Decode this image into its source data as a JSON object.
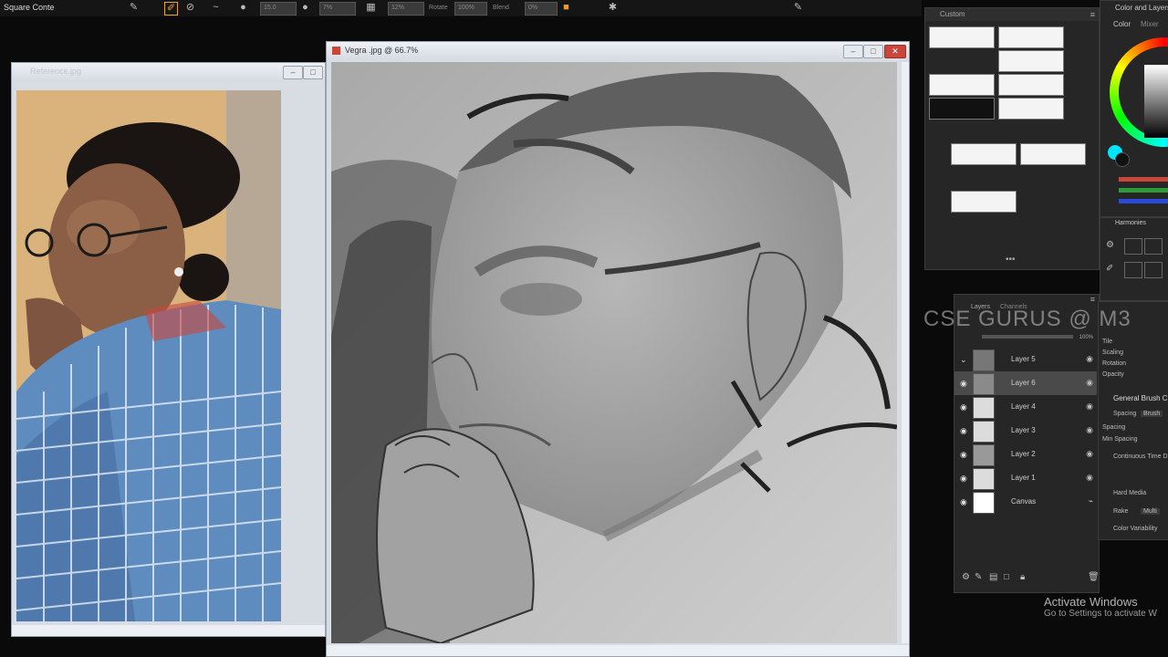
{
  "toolbar": {
    "brush_name": "Square Conte",
    "fields": [
      "15.0",
      "7%",
      "12%",
      "100%",
      "0%"
    ],
    "labels": [
      "Size",
      "Opacity",
      "Grain",
      "Rotate",
      "Blend"
    ]
  },
  "reference_window": {
    "title": "Reference.jpg"
  },
  "canvas_window": {
    "title": "Vegra  .jpg @ 66.7%"
  },
  "brush_panel": {
    "title": "Custom"
  },
  "color_panel": {
    "title": "Color and Layers",
    "tabs": [
      "Color",
      "Mixer"
    ]
  },
  "layers_panel": {
    "tabs": [
      "Layers",
      "Channels"
    ],
    "opacity": "100%",
    "layers": [
      {
        "name": "Layer 5"
      },
      {
        "name": "Layer 6"
      },
      {
        "name": "Layer 4"
      },
      {
        "name": "Layer 3"
      },
      {
        "name": "Layer 2"
      },
      {
        "name": "Layer 1"
      },
      {
        "name": "Canvas"
      }
    ]
  },
  "harmonies_panel": {
    "title": "Harmonies"
  },
  "properties_panel": {
    "items": [
      "Tile",
      "Scaling",
      "Rotation",
      "Opacity"
    ],
    "section": "General Brush C",
    "sub_items": [
      "Spacing",
      "Spacing",
      "Min Spacing",
      "Continuous Time D"
    ],
    "checks": [
      "Hard Media",
      "Rake",
      "Color Variability"
    ],
    "values": [
      "Brush",
      "Multi"
    ]
  },
  "watermark": "CSE GURUS @ M3",
  "activate": {
    "line1": "Activate Windows",
    "line2": "Go to Settings to activate W"
  },
  "colors": {
    "accent": "#c9463d",
    "panel": "#262626",
    "ref_bg": "#d9b27c"
  }
}
